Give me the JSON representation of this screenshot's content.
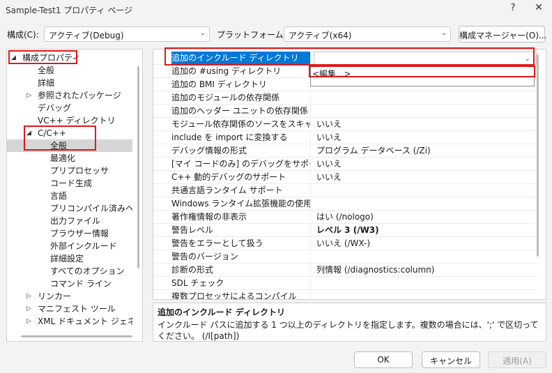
{
  "window": {
    "title": "Sample-Test1 プロパティ ページ",
    "help_label": "?",
    "close_label": "✕"
  },
  "config_bar": {
    "config_label": "構成(C):",
    "config_value": "アクティブ(Debug)",
    "platform_label": "プラットフォーム(P):",
    "platform_value": "アクティブ(x64)",
    "config_manager_label": "構成マネージャー(O)..."
  },
  "tree": {
    "items": [
      {
        "label": "構成プロパティ",
        "level": 0,
        "expanded": true
      },
      {
        "label": "全般",
        "level": 1
      },
      {
        "label": "詳細",
        "level": 1
      },
      {
        "label": "参照されたパッケージ",
        "level": 1,
        "collapsed": true
      },
      {
        "label": "デバッグ",
        "level": 1
      },
      {
        "label": "VC++ ディレクトリ",
        "level": 1
      },
      {
        "label": "C/C++",
        "level": 1,
        "expanded": true
      },
      {
        "label": "全般",
        "level": 2,
        "selected": true
      },
      {
        "label": "最適化",
        "level": 2
      },
      {
        "label": "プリプロセッサ",
        "level": 2
      },
      {
        "label": "コード生成",
        "level": 2
      },
      {
        "label": "言語",
        "level": 2
      },
      {
        "label": "プリコンパイル済みヘッダー",
        "level": 2
      },
      {
        "label": "出力ファイル",
        "level": 2
      },
      {
        "label": "ブラウザー情報",
        "level": 2
      },
      {
        "label": "外部インクルード",
        "level": 2
      },
      {
        "label": "詳細設定",
        "level": 2
      },
      {
        "label": "すべてのオプション",
        "level": 2
      },
      {
        "label": "コマンド ライン",
        "level": 2
      },
      {
        "label": "リンカー",
        "level": 1,
        "collapsed": true
      },
      {
        "label": "マニフェスト ツール",
        "level": 1,
        "collapsed": true
      },
      {
        "label": "XML ドキュメント ジェネレーター",
        "level": 1,
        "collapsed": true
      }
    ]
  },
  "grid": {
    "rows": [
      {
        "name": "追加のインクルード ディレクトリ",
        "value": "",
        "selected": true
      },
      {
        "name": "追加の #using ディレクトリ",
        "value": ""
      },
      {
        "name": "追加の BMI ディレクトリ",
        "value": ""
      },
      {
        "name": "追加のモジュールの依存関係",
        "value": ""
      },
      {
        "name": "追加のヘッダー ユニットの依存関係",
        "value": ""
      },
      {
        "name": "モジュール依存関係のソースをスキャンする",
        "value": "いいえ"
      },
      {
        "name": "include を import に変換する",
        "value": "いいえ"
      },
      {
        "name": "デバッグ情報の形式",
        "value": "プログラム データベース (/Zi)"
      },
      {
        "name": "[マイ コードのみ] のデバッグをサポートする",
        "value": "いいえ"
      },
      {
        "name": "C++ 動的デバッグのサポート",
        "value": "いいえ"
      },
      {
        "name": "共通言語ランタイム サポート",
        "value": ""
      },
      {
        "name": "Windows ランタイム拡張機能の使用",
        "value": ""
      },
      {
        "name": "著作権情報の非表示",
        "value": "はい (/nologo)"
      },
      {
        "name": "警告レベル",
        "value": "レベル 3 (/W3)",
        "bold": true
      },
      {
        "name": "警告をエラーとして扱う",
        "value": "いいえ (/WX-)"
      },
      {
        "name": "警告のバージョン",
        "value": ""
      },
      {
        "name": "診断の形式",
        "value": "列情報 (/diagnostics:column)"
      },
      {
        "name": "SDL チェック",
        "value": ""
      },
      {
        "name": "複数プロセッサによるコンパイル",
        "value": ""
      }
    ],
    "dropdown_item": "<編集...>"
  },
  "description": {
    "title": "追加のインクルード ディレクトリ",
    "text": "インクルード パスに追加する 1 つ以上のディレクトリを指定します。複数の場合には、';' で区切ってください。 (/I[path])"
  },
  "buttons": {
    "ok": "OK",
    "cancel": "キャンセル",
    "apply": "適用(A)"
  },
  "colors": {
    "selection_blue": "#0078d7",
    "annotation_red": "#e01818"
  }
}
